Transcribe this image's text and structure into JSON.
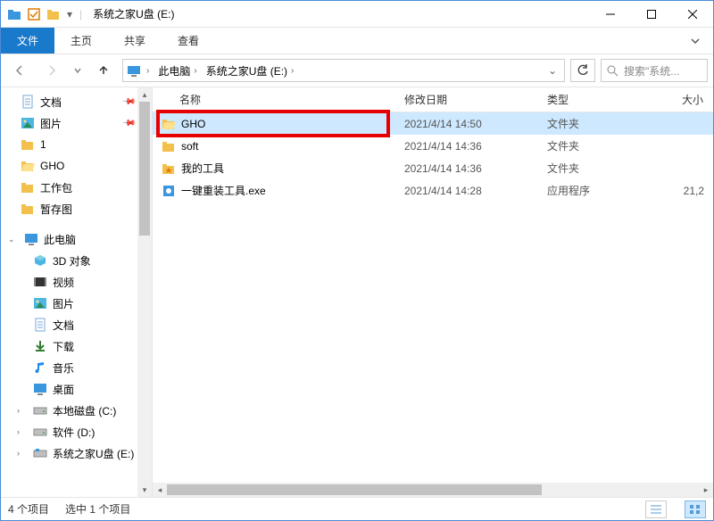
{
  "title": "系统之家U盘 (E:)",
  "ribbon": {
    "file": "文件",
    "home": "主页",
    "share": "共享",
    "view": "查看"
  },
  "breadcrumb": {
    "this_pc": "此电脑",
    "drive": "系统之家U盘 (E:)"
  },
  "search": {
    "placeholder": "搜索\"系统..."
  },
  "nav": {
    "quick": [
      {
        "label": "文档",
        "pin": true,
        "icon": "doc"
      },
      {
        "label": "图片",
        "pin": true,
        "icon": "pic"
      },
      {
        "label": "1",
        "pin": false,
        "icon": "folder"
      },
      {
        "label": "GHO",
        "pin": false,
        "icon": "folder-open"
      },
      {
        "label": "工作包",
        "pin": false,
        "icon": "folder"
      },
      {
        "label": "暂存图",
        "pin": false,
        "icon": "folder"
      }
    ],
    "this_pc": "此电脑",
    "pc_items": [
      {
        "label": "3D 对象",
        "icon": "3d"
      },
      {
        "label": "视频",
        "icon": "video"
      },
      {
        "label": "图片",
        "icon": "pic"
      },
      {
        "label": "文档",
        "icon": "doc"
      },
      {
        "label": "下载",
        "icon": "download"
      },
      {
        "label": "音乐",
        "icon": "music"
      },
      {
        "label": "桌面",
        "icon": "desktop"
      },
      {
        "label": "本地磁盘 (C:)",
        "icon": "drive"
      },
      {
        "label": "软件 (D:)",
        "icon": "drive"
      },
      {
        "label": "系统之家U盘 (E:)",
        "icon": "usb"
      }
    ]
  },
  "columns": {
    "name": "名称",
    "date": "修改日期",
    "type": "类型",
    "size": "大小"
  },
  "rows": [
    {
      "name": "GHO",
      "date": "2021/4/14 14:50",
      "type": "文件夹",
      "size": "",
      "icon": "folder-open",
      "selected": true,
      "highlight": true
    },
    {
      "name": "soft",
      "date": "2021/4/14 14:36",
      "type": "文件夹",
      "size": "",
      "icon": "folder",
      "selected": false
    },
    {
      "name": "我的工具",
      "date": "2021/4/14 14:36",
      "type": "文件夹",
      "size": "",
      "icon": "folder-fav",
      "selected": false
    },
    {
      "name": "一键重装工具.exe",
      "date": "2021/4/14 14:28",
      "type": "应用程序",
      "size": "21,2",
      "icon": "exe",
      "selected": false
    }
  ],
  "status": {
    "count": "4 个项目",
    "selected": "选中 1 个项目"
  }
}
